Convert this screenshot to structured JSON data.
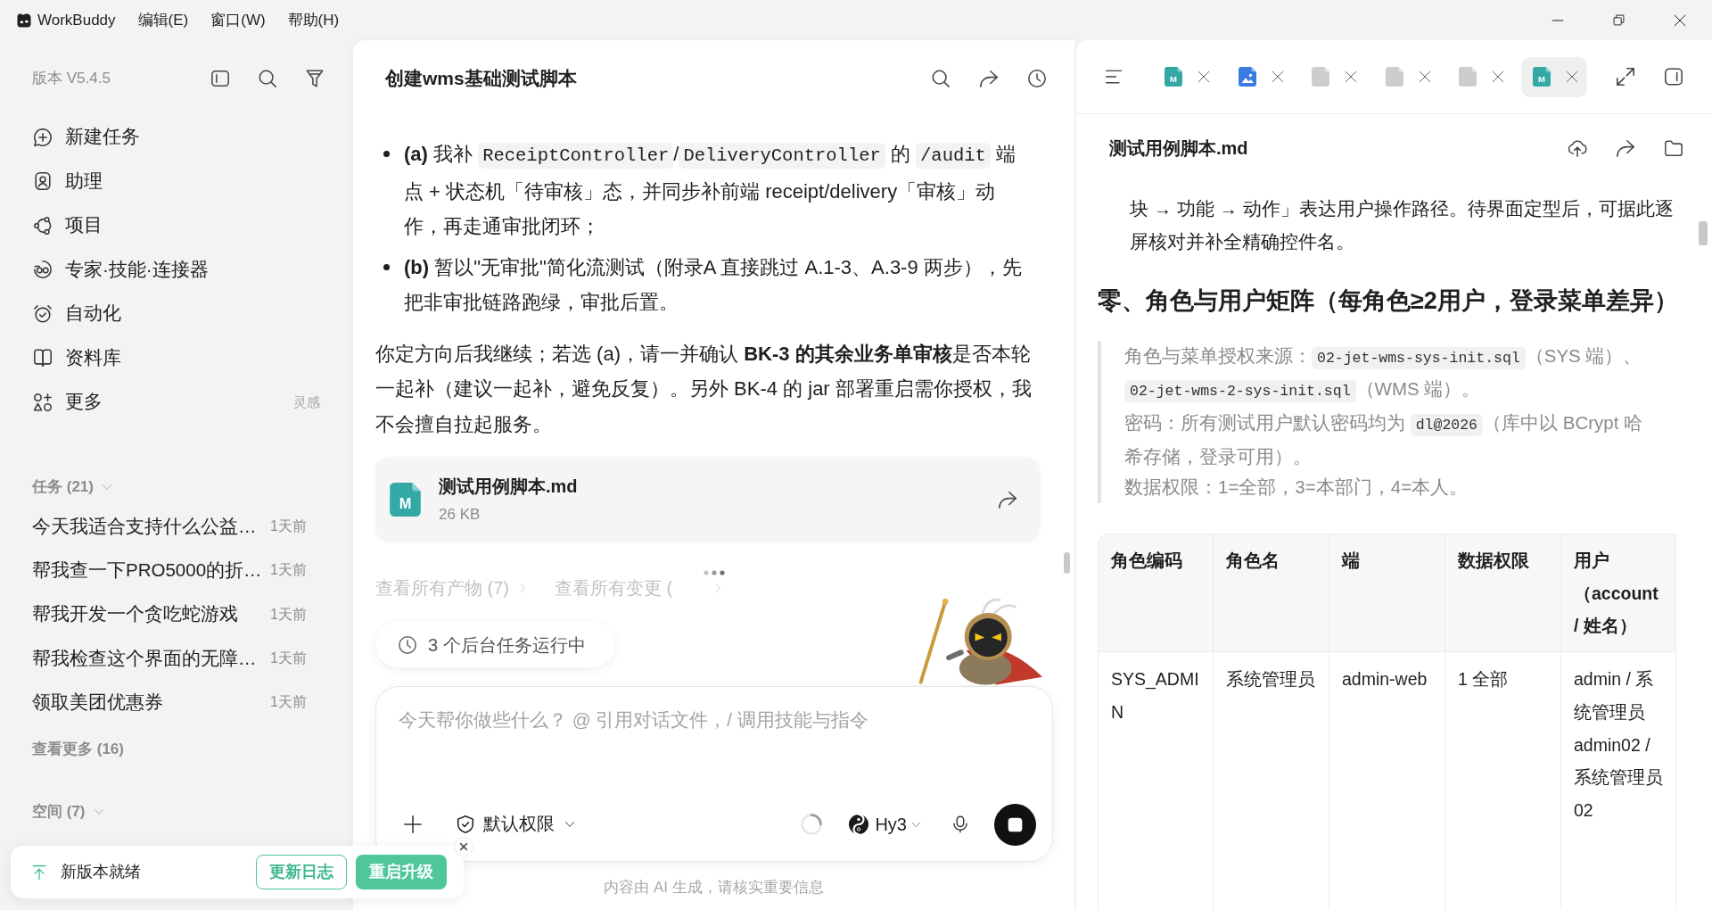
{
  "title_bar": {
    "app_name": "WorkBuddy",
    "menus": [
      {
        "label": "编辑(E)"
      },
      {
        "label": "窗口(W)"
      },
      {
        "label": "帮助(H)"
      }
    ]
  },
  "sidebar": {
    "version": "版本 V5.4.5",
    "nav": [
      {
        "kind": "new_task",
        "label": "新建任务"
      },
      {
        "kind": "assistant",
        "label": "助理"
      },
      {
        "kind": "projects",
        "label": "项目"
      },
      {
        "kind": "experts",
        "label": "专家·技能·连接器"
      },
      {
        "kind": "automation",
        "label": "自动化"
      },
      {
        "kind": "library",
        "label": "资料库"
      },
      {
        "kind": "more",
        "label": "更多",
        "hint": "灵感"
      }
    ],
    "tasks": {
      "title": "任务 (21)",
      "expanded": true,
      "items": [
        {
          "title": "今天我适合支持什么公益…",
          "time": "1天前"
        },
        {
          "title": "帮我查一下PRO5000的折…",
          "time": "1天前"
        },
        {
          "title": "帮我开发一个贪吃蛇游戏",
          "time": "1天前"
        },
        {
          "title": "帮我检查这个界面的无障…",
          "time": "1天前"
        },
        {
          "title": "领取美团优惠券",
          "time": "1天前"
        }
      ],
      "more": "查看更多 (16)"
    },
    "spaces": {
      "title": "空间 (7)",
      "expanded": true
    }
  },
  "update_banner": {
    "message": "新版本就绪",
    "buttons": [
      {
        "kind": "outline",
        "label": "更新日志"
      },
      {
        "kind": "primary",
        "label": "重启升级"
      }
    ]
  },
  "chat": {
    "title": "创建wms基础测试脚本",
    "bullets": [
      [
        {
          "kind": "bold",
          "text": "(a)"
        },
        {
          "kind": "plain",
          "text": " 我补 "
        },
        {
          "kind": "code",
          "text": "ReceiptController"
        },
        {
          "kind": "plain",
          "text": "/"
        },
        {
          "kind": "code",
          "text": "DeliveryController"
        },
        {
          "kind": "plain",
          "text": " 的 "
        },
        {
          "kind": "code",
          "text": "/audit"
        },
        {
          "kind": "plain",
          "text": " 端点 + 状态机「待审核」态，并同步补前端 receipt/delivery「审核」动作，再走通审批闭环；"
        }
      ],
      [
        {
          "kind": "bold",
          "text": "(b)"
        },
        {
          "kind": "plain",
          "text": " 暂以\"无审批\"简化流测试（附录A 直接跳过 A.1-3、A.3-9 两步），先把非审批链路跑绿，审批后置。"
        }
      ]
    ],
    "paragraph": [
      {
        "kind": "plain",
        "text": "你定方向后我继续；若选 (a)，请一并确认 "
      },
      {
        "kind": "bold",
        "text": "BK-3 的其余业务单审核"
      },
      {
        "kind": "plain",
        "text": "是否本轮一起补（建议一起补，避免反复）。另外 BK-4 的 jar 部署重启需你授权，我不会擅自拉起服务。"
      }
    ],
    "file_card": {
      "kind": "markdown",
      "icon_letter": "M",
      "name": "测试用例脚本.md",
      "size": "26 KB"
    },
    "links": [
      "查看所有产物 (7)",
      "查看所有变更 ("
    ],
    "background_tasks": "3 个后台任务运行中",
    "composer": {
      "placeholder": "今天帮你做些什么？ @ 引用对话文件，/ 调用技能与指令",
      "permission": "默认权限",
      "model": "Hy3",
      "running": true
    },
    "disclaimer": "内容由 AI 生成，请核实重要信息"
  },
  "preview": {
    "tabs": [
      {
        "kind": "markdown",
        "icon_letter": "M",
        "selected": false
      },
      {
        "kind": "image",
        "selected": false
      },
      {
        "kind": "file",
        "selected": false
      },
      {
        "kind": "file",
        "selected": false
      },
      {
        "kind": "file",
        "selected": false
      },
      {
        "kind": "markdown",
        "icon_letter": "M",
        "selected": true
      }
    ],
    "document": {
      "title": "测试用例脚本.md",
      "list_continuation": "块 → 功能 → 动作」表达用户操作路径。待界面定型后，可据此逐屏核对并补全精确控件名。",
      "heading": "零、角色与用户矩阵（每角色≥2用户，登录菜单差异）",
      "quote": [
        [
          {
            "kind": "plain",
            "text": "角色与菜单授权来源："
          },
          {
            "kind": "code",
            "text": "02-jet-wms-sys-init.sql"
          },
          {
            "kind": "plain",
            "text": "（SYS 端）、"
          },
          {
            "kind": "code",
            "text": "02-jet-wms-2-sys-init.sql"
          },
          {
            "kind": "plain",
            "text": "（WMS 端）。"
          }
        ],
        [
          {
            "kind": "plain",
            "text": "密码：所有测试用户默认密码均为 "
          },
          {
            "kind": "code",
            "text": "dl@2026"
          },
          {
            "kind": "plain",
            "text": "（库中以 BCrypt 哈希存储，登录可用）。"
          }
        ],
        [
          {
            "kind": "plain",
            "text": "数据权限：1=全部，3=本部门，4=本人。"
          }
        ]
      ],
      "table": {
        "columns": [
          "角色编码",
          "角色名",
          "端",
          "数据权限",
          "用户（account / 姓名）"
        ],
        "rows": [
          {
            "cells": [
              "SYS_ADMIN",
              "系统管理员",
              "admin-web",
              "1 全部"
            ],
            "users": [
              "admin / 系统管理员",
              "admin02 / 系统管理员02"
            ]
          }
        ]
      }
    }
  }
}
